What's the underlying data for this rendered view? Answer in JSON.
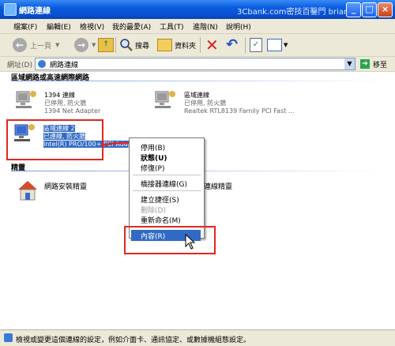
{
  "window": {
    "title": "網路連線",
    "watermark": "3Cbank.com密技百鑿門 brian"
  },
  "menu": [
    "檔案(F)",
    "編輯(E)",
    "檢視(V)",
    "我的最愛(A)",
    "工具(T)",
    "進階(N)",
    "說明(H)"
  ],
  "toolbar": {
    "back_label": "上一頁",
    "search_label": "搜尋",
    "folders_label": "資料夾"
  },
  "address": {
    "label": "網址(D)",
    "value": "網路連線",
    "go_label": "移至"
  },
  "groups": {
    "lan": "區域網路或高速網際網路",
    "wizard": "精靈"
  },
  "connections": {
    "c1394": {
      "name": "1394 連線",
      "status": "已停用, 防火牆",
      "device": "1394 Net Adapter"
    },
    "lan1": {
      "name": "區域連線",
      "status": "已停用, 防火牆",
      "device": "Realtek RTL8139 Family PCI Fast ..."
    },
    "lan2": {
      "name": "區域連線 2",
      "status": "已連線, 防火牆",
      "device": "Intel(R) PRO/100+ PCI Adapter"
    }
  },
  "wizards": {
    "install": "網路安裝精靈",
    "new_conn": "連線精靈"
  },
  "context_menu": {
    "disable": "停用(B)",
    "status": "狀態(U)",
    "repair": "修復(P)",
    "bridge": "橋接器連線(G)",
    "shortcut": "建立捷徑(S)",
    "delete": "刪除(D)",
    "rename": "重新命名(M)",
    "properties": "內容(R)"
  },
  "status_bar": "檢視或變更這個連線的設定，例如介面卡、通訊協定、或數據機組態設定。",
  "colors": {
    "title_bar": "#0a5ce0",
    "selection": "#316ac5",
    "annotation_red": "#e3261f"
  }
}
